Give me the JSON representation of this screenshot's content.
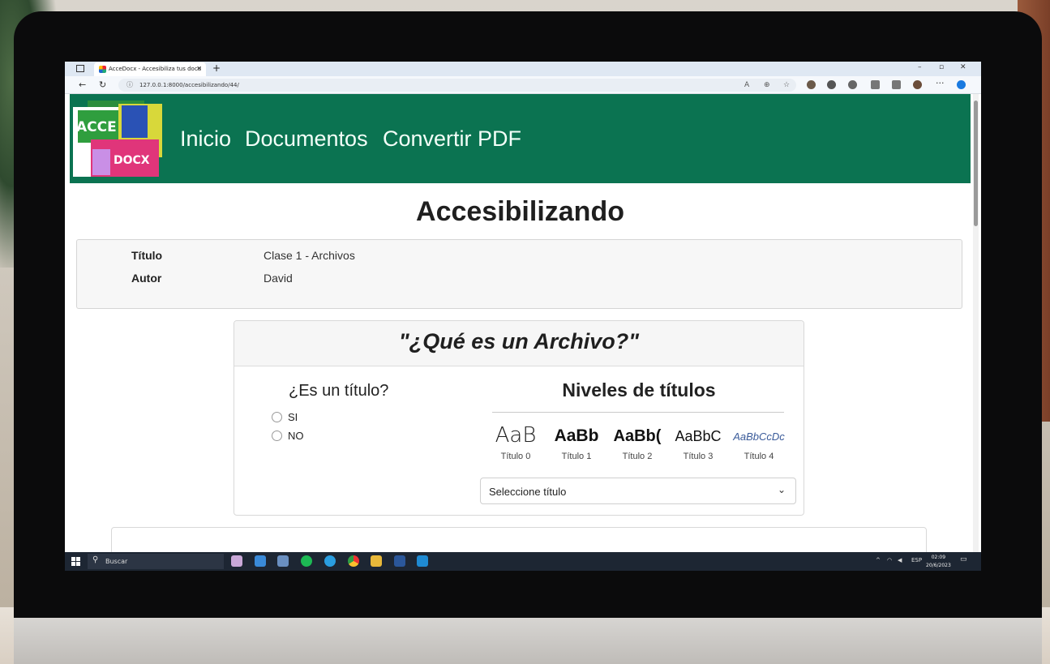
{
  "browser": {
    "tab_title": "AcceDocx - Accesibiliza tus docu",
    "tab_close": "✕",
    "new_tab": "+",
    "url": "127.0.0.1:8000/accesibilizando/44/"
  },
  "logo": {
    "top_text": "ACCE",
    "bottom_text": "DOCX"
  },
  "nav": {
    "items": [
      "Inicio",
      "Documentos",
      "Convertir PDF"
    ]
  },
  "page": {
    "title": "Accesibilizando",
    "meta": [
      {
        "label": "Título",
        "value": "Clase 1 - Archivos"
      },
      {
        "label": "Autor",
        "value": "David"
      }
    ]
  },
  "question": {
    "title": "\"¿Qué es un Archivo?\"",
    "is_title_prompt": "¿Es un título?",
    "options": [
      "SI",
      "NO"
    ],
    "levels_heading": "Niveles de títulos",
    "styles": [
      {
        "sample": "AaB",
        "caption": "Título 0"
      },
      {
        "sample": "AaBb",
        "caption": "Título 1"
      },
      {
        "sample": "AaBb(",
        "caption": "Título 2"
      },
      {
        "sample": "AaBbC",
        "caption": "Título 3"
      },
      {
        "sample": "AaBbCcDc",
        "caption": "Título 4"
      }
    ],
    "select_placeholder": "Seleccione título"
  },
  "taskbar": {
    "search": "Buscar",
    "lang": "ESP",
    "time": "02:09",
    "date": "20/6/2023"
  },
  "colors": {
    "navbar": "#0b7351",
    "taskbar": "#1d2633"
  }
}
